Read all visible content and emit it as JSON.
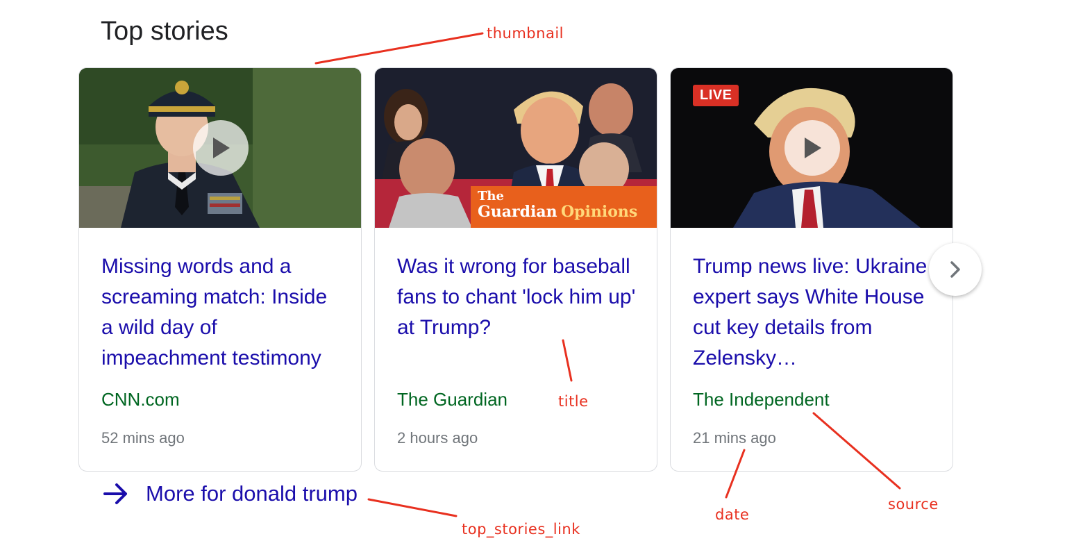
{
  "heading": "Top stories",
  "stories": [
    {
      "title": "Missing words and a screaming match: Inside a wild day of impeachment testimony",
      "source": "CNN.com",
      "time": "52 mins ago",
      "has_video": true
    },
    {
      "title": "Was it wrong for baseball fans to chant 'lock him up' at Trump?",
      "source": "The Guardian",
      "time": "2 hours ago",
      "has_video": false,
      "overlay_brand": "The",
      "overlay_brand_main": "Guardian",
      "overlay_brand_section": "Opinions"
    },
    {
      "title": "Trump news live: Ukraine expert says White House cut key details from Zelensky…",
      "source": "The Independent",
      "time": "21 mins ago",
      "has_video": true,
      "badge": "LIVE"
    }
  ],
  "more_link": "More for donald trump",
  "annotations": {
    "thumbnail": "thumbnail",
    "title": "title",
    "date": "date",
    "source": "source",
    "top_stories_link": "top_stories_link"
  },
  "colors": {
    "title": "#1a0dab",
    "source": "#006621",
    "time": "#70757a",
    "annotation": "#e8301f",
    "live_badge": "#d93025",
    "guardian_orange": "#e8601c"
  },
  "icons": {
    "play": "play-icon",
    "next": "chevron-right-icon",
    "more": "arrow-right-icon"
  }
}
